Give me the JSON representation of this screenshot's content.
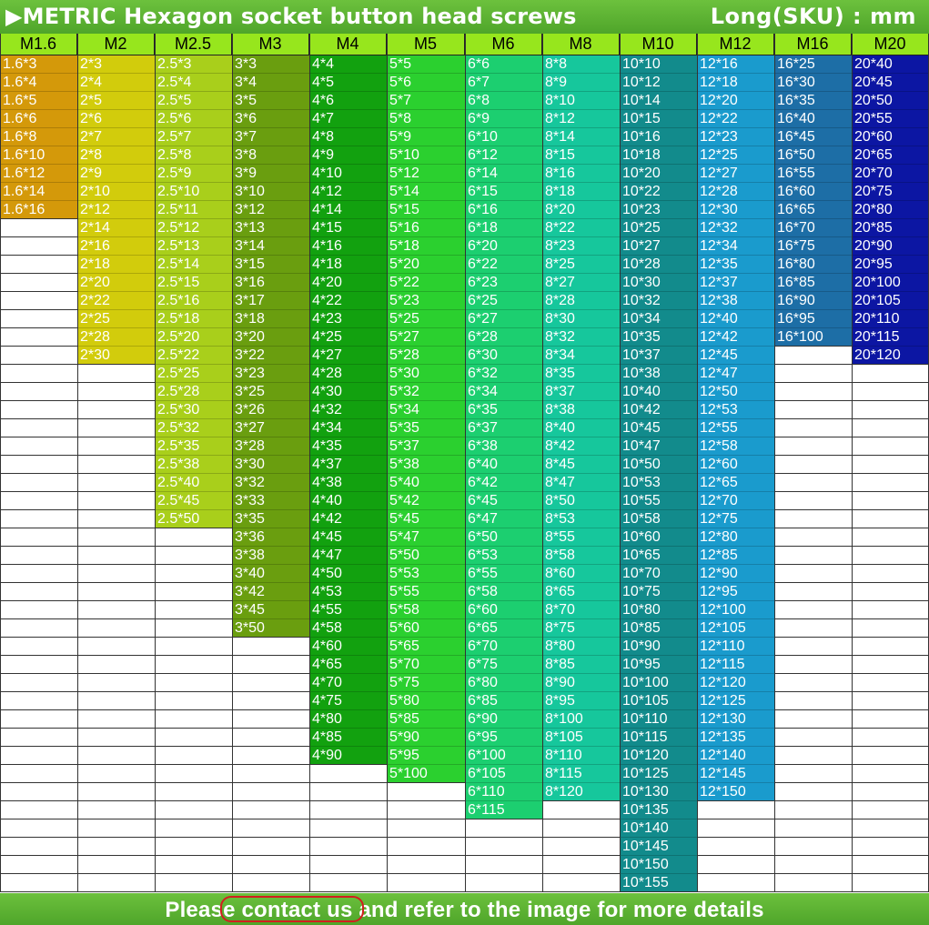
{
  "title": {
    "left": "▶METRIC Hexagon socket button head screws",
    "right": "Long(SKU)  :  mm"
  },
  "footer": {
    "text": "Please contact us and refer to the image for more details"
  },
  "columns": [
    {
      "header": "M1.6",
      "color": "#d4990a",
      "text_color": "#ffffff",
      "items": [
        "1.6*3",
        "1.6*4",
        "1.6*5",
        "1.6*6",
        "1.6*8",
        "1.6*10",
        "1.6*12",
        "1.6*14",
        "1.6*16"
      ]
    },
    {
      "header": "M2",
      "color": "#d2cc0c",
      "text_color": "#ffffff",
      "items": [
        "2*3",
        "2*4",
        "2*5",
        "2*6",
        "2*7",
        "2*8",
        "2*9",
        "2*10",
        "2*12",
        "2*14",
        "2*16",
        "2*18",
        "2*20",
        "2*22",
        "2*25",
        "2*28",
        "2*30"
      ]
    },
    {
      "header": "M2.5",
      "color": "#a9cf1b",
      "text_color": "#ffffff",
      "items": [
        "2.5*3",
        "2.5*4",
        "2.5*5",
        "2.5*6",
        "2.5*7",
        "2.5*8",
        "2.5*9",
        "2.5*10",
        "2.5*11",
        "2.5*12",
        "2.5*13",
        "2.5*14",
        "2.5*15",
        "2.5*16",
        "2.5*18",
        "2.5*20",
        "2.5*22",
        "2.5*25",
        "2.5*28",
        "2.5*30",
        "2.5*32",
        "2.5*35",
        "2.5*38",
        "2.5*40",
        "2.5*45",
        "2.5*50"
      ]
    },
    {
      "header": "M3",
      "color": "#6a9e0f",
      "text_color": "#ffffff",
      "items": [
        "3*3",
        "3*4",
        "3*5",
        "3*6",
        "3*7",
        "3*8",
        "3*9",
        "3*10",
        "3*12",
        "3*13",
        "3*14",
        "3*15",
        "3*16",
        "3*17",
        "3*18",
        "3*20",
        "3*22",
        "3*23",
        "3*25",
        "3*26",
        "3*27",
        "3*28",
        "3*30",
        "3*32",
        "3*33",
        "3*35",
        "3*36",
        "3*38",
        "3*40",
        "3*42",
        "3*45",
        "3*50"
      ]
    },
    {
      "header": "M4",
      "color": "#12a10f",
      "text_color": "#ffffff",
      "items": [
        "4*4",
        "4*5",
        "4*6",
        "4*7",
        "4*8",
        "4*9",
        "4*10",
        "4*12",
        "4*14",
        "4*15",
        "4*16",
        "4*18",
        "4*20",
        "4*22",
        "4*23",
        "4*25",
        "4*27",
        "4*28",
        "4*30",
        "4*32",
        "4*34",
        "4*35",
        "4*37",
        "4*38",
        "4*40",
        "4*42",
        "4*45",
        "4*47",
        "4*50",
        "4*53",
        "4*55",
        "4*58",
        "4*60",
        "4*65",
        "4*70",
        "4*75",
        "4*80",
        "4*85",
        "4*90"
      ]
    },
    {
      "header": "M5",
      "color": "#2bd02f",
      "text_color": "#ffffff",
      "items": [
        "5*5",
        "5*6",
        "5*7",
        "5*8",
        "5*9",
        "5*10",
        "5*12",
        "5*14",
        "5*15",
        "5*16",
        "5*18",
        "5*20",
        "5*22",
        "5*23",
        "5*25",
        "5*27",
        "5*28",
        "5*30",
        "5*32",
        "5*34",
        "5*35",
        "5*37",
        "5*38",
        "5*40",
        "5*42",
        "5*45",
        "5*47",
        "5*50",
        "5*53",
        "5*55",
        "5*58",
        "5*60",
        "5*65",
        "5*70",
        "5*75",
        "5*80",
        "5*85",
        "5*90",
        "5*95",
        "5*100"
      ]
    },
    {
      "header": "M6",
      "color": "#1ccf70",
      "text_color": "#ffffff",
      "items": [
        "6*6",
        "6*7",
        "6*8",
        "6*9",
        "6*10",
        "6*12",
        "6*14",
        "6*15",
        "6*16",
        "6*18",
        "6*20",
        "6*22",
        "6*23",
        "6*25",
        "6*27",
        "6*28",
        "6*30",
        "6*32",
        "6*34",
        "6*35",
        "6*37",
        "6*38",
        "6*40",
        "6*42",
        "6*45",
        "6*47",
        "6*50",
        "6*53",
        "6*55",
        "6*58",
        "6*60",
        "6*65",
        "6*70",
        "6*75",
        "6*80",
        "6*85",
        "6*90",
        "6*95",
        "6*100",
        "6*105",
        "6*110",
        "6*115"
      ]
    },
    {
      "header": "M8",
      "color": "#16c79c",
      "text_color": "#ffffff",
      "items": [
        "8*8",
        "8*9",
        "8*10",
        "8*12",
        "8*14",
        "8*15",
        "8*16",
        "8*18",
        "8*20",
        "8*22",
        "8*23",
        "8*25",
        "8*27",
        "8*28",
        "8*30",
        "8*32",
        "8*34",
        "8*35",
        "8*37",
        "8*38",
        "8*40",
        "8*42",
        "8*45",
        "8*47",
        "8*50",
        "8*53",
        "8*55",
        "8*58",
        "8*60",
        "8*65",
        "8*70",
        "8*75",
        "8*80",
        "8*85",
        "8*90",
        "8*95",
        "8*100",
        "8*105",
        "8*110",
        "8*115",
        "8*120"
      ]
    },
    {
      "header": "M10",
      "color": "#128b8c",
      "text_color": "#ffffff",
      "items": [
        "10*10",
        "10*12",
        "10*14",
        "10*15",
        "10*16",
        "10*18",
        "10*20",
        "10*22",
        "10*23",
        "10*25",
        "10*27",
        "10*28",
        "10*30",
        "10*32",
        "10*34",
        "10*35",
        "10*37",
        "10*38",
        "10*40",
        "10*42",
        "10*45",
        "10*47",
        "10*50",
        "10*53",
        "10*55",
        "10*58",
        "10*60",
        "10*65",
        "10*70",
        "10*75",
        "10*80",
        "10*85",
        "10*90",
        "10*95",
        "10*100",
        "10*105",
        "10*110",
        "10*115",
        "10*120",
        "10*125",
        "10*130",
        "10*135",
        "10*140",
        "10*145",
        "10*150",
        "10*155"
      ]
    },
    {
      "header": "M12",
      "color": "#1a9bcd",
      "text_color": "#ffffff",
      "items": [
        "12*16",
        "12*18",
        "12*20",
        "12*22",
        "12*23",
        "12*25",
        "12*27",
        "12*28",
        "12*30",
        "12*32",
        "12*34",
        "12*35",
        "12*37",
        "12*38",
        "12*40",
        "12*42",
        "12*45",
        "12*47",
        "12*50",
        "12*53",
        "12*55",
        "12*58",
        "12*60",
        "12*65",
        "12*70",
        "12*75",
        "12*80",
        "12*85",
        "12*90",
        "12*95",
        "12*100",
        "12*105",
        "12*110",
        "12*115",
        "12*120",
        "12*125",
        "12*130",
        "12*135",
        "12*140",
        "12*145",
        "12*150"
      ]
    },
    {
      "header": "M16",
      "color": "#1d6ea6",
      "text_color": "#ffffff",
      "items": [
        "16*25",
        "16*30",
        "16*35",
        "16*40",
        "16*45",
        "16*50",
        "16*55",
        "16*60",
        "16*65",
        "16*70",
        "16*75",
        "16*80",
        "16*85",
        "16*90",
        "16*95",
        "16*100"
      ]
    },
    {
      "header": "M20",
      "color": "#0c16a3",
      "text_color": "#ffffff",
      "items": [
        "20*40",
        "20*45",
        "20*50",
        "20*55",
        "20*60",
        "20*65",
        "20*70",
        "20*75",
        "20*80",
        "20*85",
        "20*90",
        "20*95",
        "20*100",
        "20*105",
        "20*110",
        "20*115",
        "20*120"
      ]
    }
  ]
}
